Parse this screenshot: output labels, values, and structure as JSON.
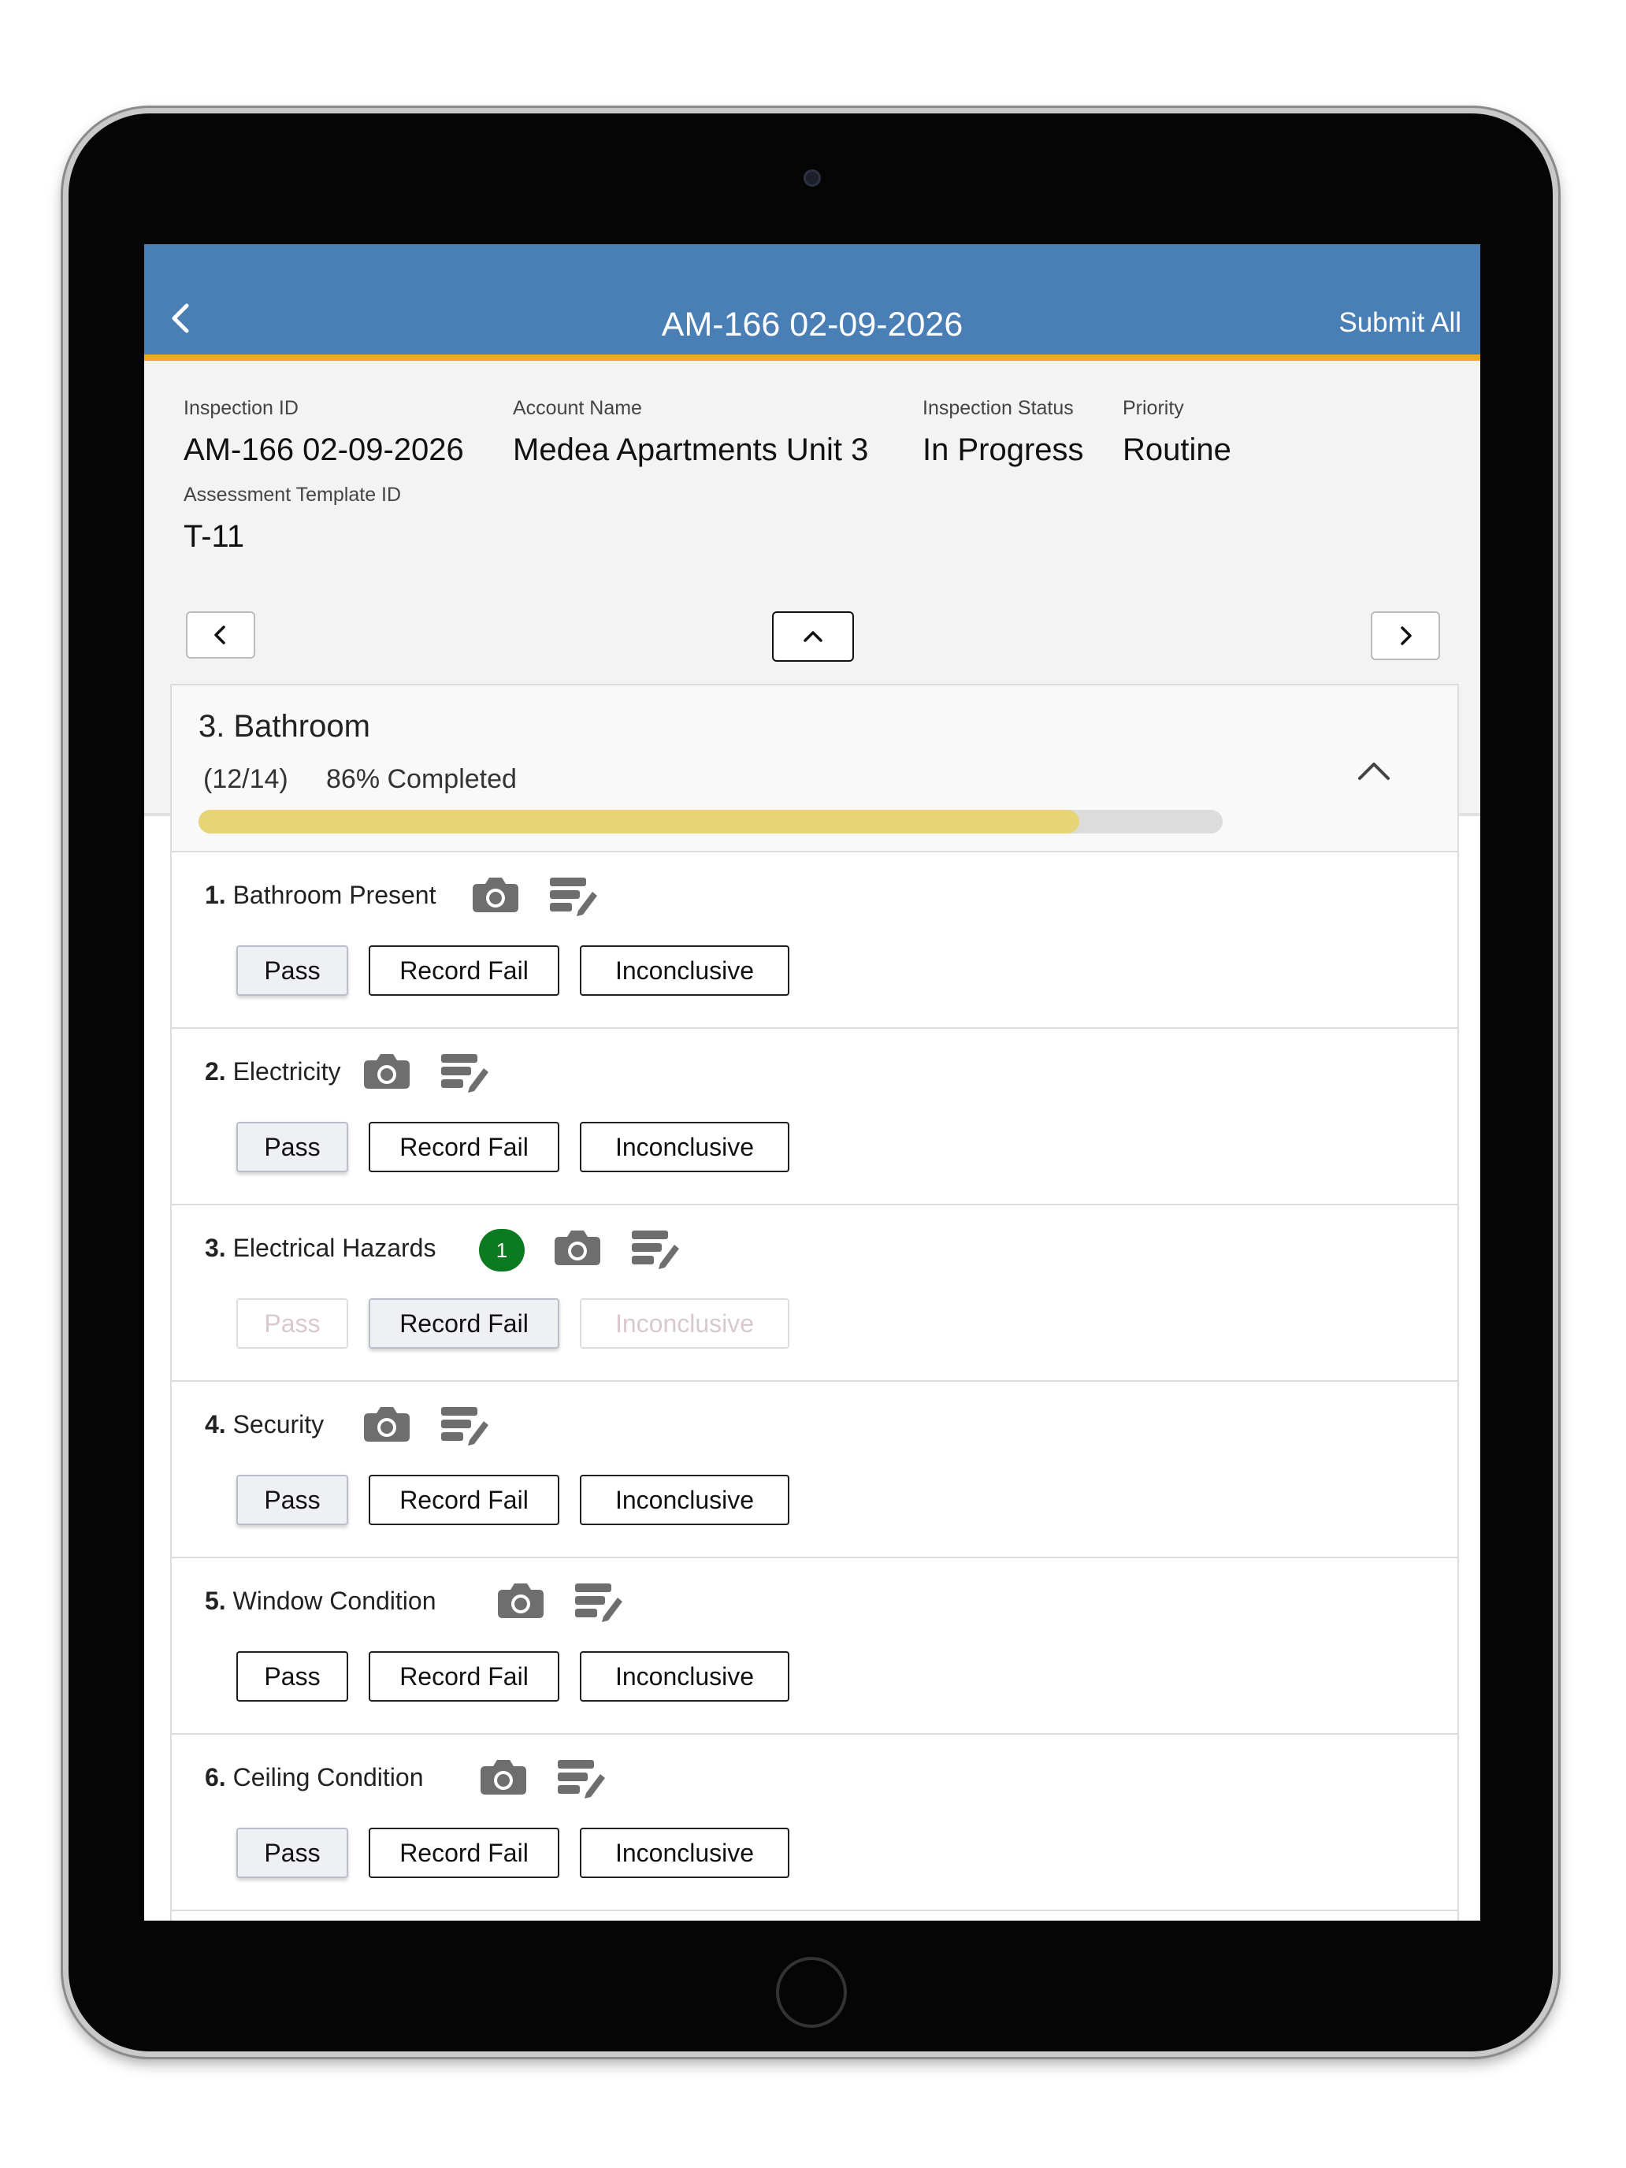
{
  "header": {
    "title": "AM-166 02-09-2026",
    "submit_label": "Submit All"
  },
  "info": {
    "inspection_id_label": "Inspection ID",
    "inspection_id": "AM-166 02-09-2026",
    "account_name_label": "Account Name",
    "account_name": "Medea Apartments Unit 3",
    "status_label": "Inspection Status",
    "status": "In Progress",
    "priority_label": "Priority",
    "priority": "Routine",
    "template_label": "Assessment Template ID",
    "template_id": "T-11"
  },
  "section": {
    "title": "3. Bathroom",
    "count": "(12/14)",
    "progress_text": "86% Completed",
    "progress_fraction": 0.86
  },
  "items": [
    {
      "num": "1.",
      "label": "Bathroom Present",
      "badge": "",
      "pass": "Pass",
      "fail": "Record Fail",
      "inconclusive": "Inconclusive",
      "selected": "pass"
    },
    {
      "num": "2.",
      "label": "Electricity",
      "badge": "",
      "pass": "Pass",
      "fail": "Record Fail",
      "inconclusive": "Inconclusive",
      "selected": "pass"
    },
    {
      "num": "3.",
      "label": "Electrical Hazards",
      "badge": "1",
      "pass": "Pass",
      "fail": "Record Fail",
      "inconclusive": "Inconclusive",
      "selected": "fail"
    },
    {
      "num": "4.",
      "label": "Security",
      "badge": "",
      "pass": "Pass",
      "fail": "Record Fail",
      "inconclusive": "Inconclusive",
      "selected": "pass"
    },
    {
      "num": "5.",
      "label": "Window Condition",
      "badge": "",
      "pass": "Pass",
      "fail": "Record Fail",
      "inconclusive": "Inconclusive",
      "selected": "none"
    },
    {
      "num": "6.",
      "label": "Ceiling Condition",
      "badge": "",
      "pass": "Pass",
      "fail": "Record Fail",
      "inconclusive": "Inconclusive",
      "selected": "pass"
    }
  ],
  "icons": {
    "back": "chevron-left-icon",
    "previous": "chevron-left-icon",
    "up": "chevron-up-icon",
    "next": "chevron-right-icon",
    "collapse": "chevron-up-icon",
    "camera": "camera-icon",
    "notes": "notes-edit-icon"
  },
  "colors": {
    "header": "#4a7fb5",
    "header_accent": "#f2a825",
    "progress_fill": "#e6d476",
    "badge": "#0c7a20"
  }
}
